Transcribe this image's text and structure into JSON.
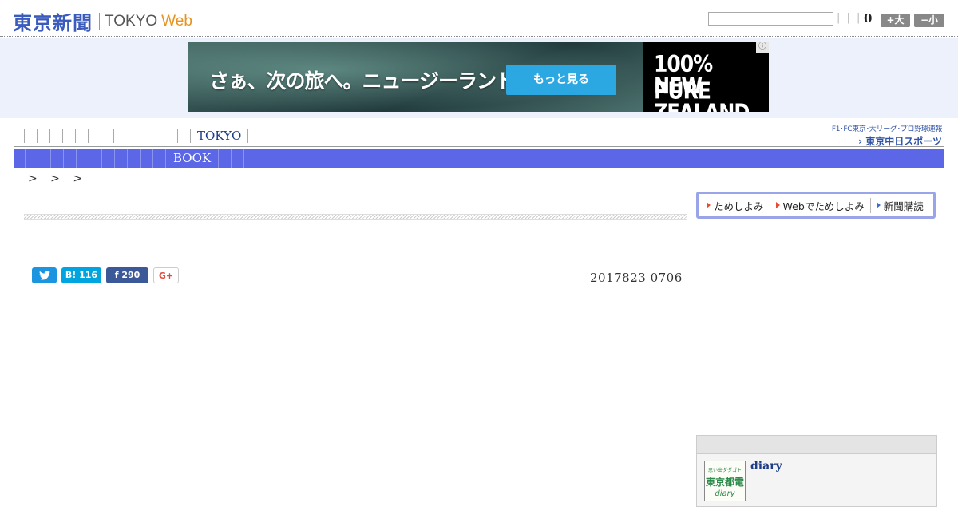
{
  "header": {
    "logo_jp": "東京新聞",
    "logo_en": "TOKYO",
    "logo_web": "Web",
    "search_placeholder": "",
    "pipes": "| | |",
    "count": "0",
    "font_bigger": "+大",
    "font_smaller": "−小"
  },
  "ad": {
    "copy": "さぁ、次の旅へ。ニュージーランド",
    "cta": "もっと見る",
    "brand_line1": "100% PURE",
    "brand_line2": "NEW ZEALAND",
    "info_icon": "ⓘ"
  },
  "topnav": {
    "tokyo_label": "TOKYO"
  },
  "promo": {
    "line1": "F1･FC東京･大リーグ･プロ野球速報",
    "line2": "› 東京中日スポーツ"
  },
  "mainnav": {
    "book_label": "BOOK"
  },
  "breadcrumb": "> > >",
  "share": {
    "twitter_icon": "twitter-bird",
    "hatena_label": "B! 116",
    "facebook_label": "f  290",
    "gplus_label": "G+"
  },
  "article": {
    "date": "2017823 0706"
  },
  "trial_bar": {
    "item1": "ためしよみ",
    "item2": "Webでためしよみ",
    "item3": "新聞購読"
  },
  "diary": {
    "thumb_line1": "思い出ダダゴト",
    "thumb_line2": "東京都電",
    "thumb_line3": "diary",
    "title": "diary"
  },
  "colors": {
    "brand_blue": "#3a5bbd",
    "web_orange": "#e8931e",
    "nav_bar": "#5b67e6",
    "ad_cta": "#2ba7e2"
  }
}
